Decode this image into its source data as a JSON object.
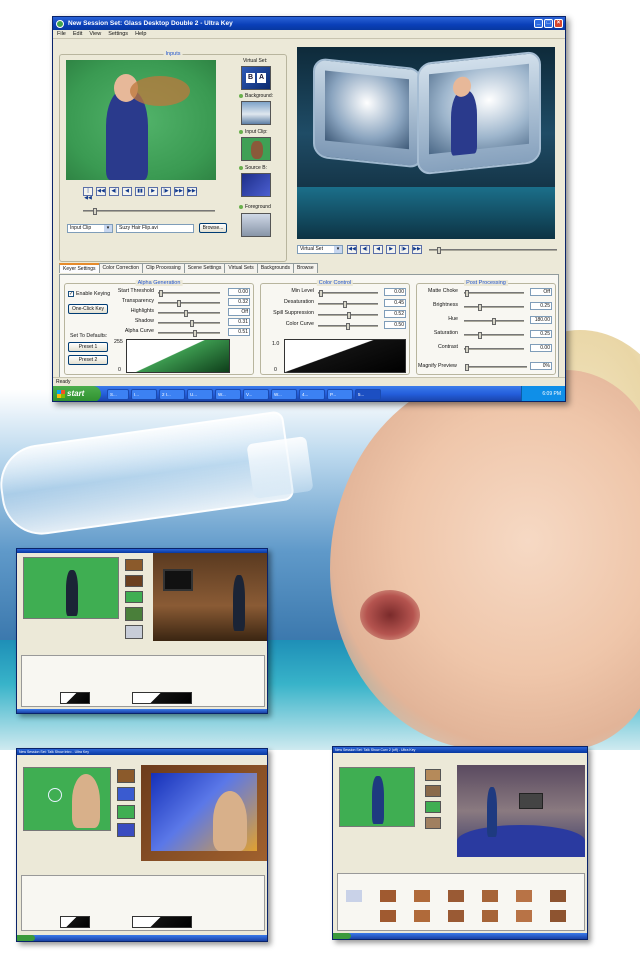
{
  "window": {
    "title": "New Session   Set: Glass Desktop Double 2  - Ultra Key",
    "menu": [
      "File",
      "Edit",
      "View",
      "Settings",
      "Help"
    ]
  },
  "inputs": {
    "group_title": "Inputs",
    "virtual_set_label": "Virtual Set:",
    "background_label": "Background:",
    "input_clip_label": "Input Clip:",
    "source_b_label": "Source B:",
    "foreground_label": "Foreground",
    "transport": [
      "|◀◀",
      "◀◀",
      "◀|",
      "◀",
      "▮▮",
      "▶",
      "|▶",
      "▶▶",
      "▶▶|"
    ],
    "source_select": "Input Clip",
    "file_name": "Suzy Hair Flip.avi",
    "browse_label": "Browse..."
  },
  "output": {
    "view_select": "Virtual Set",
    "transport": [
      "◀◀",
      "◀|",
      "◀",
      "▶",
      "|▶",
      "▶▶"
    ]
  },
  "tabs": [
    "Keyer Settings",
    "Color Correction",
    "Clip Processing",
    "Scene Settings",
    "Virtual Sets",
    "Backgrounds",
    "Browse"
  ],
  "alpha_generation": {
    "title": "Alpha Generation",
    "enable_keying_label": "Enable Keying",
    "one_click_key_label": "One-Click Key",
    "defaults_label": "Set To Defaults:",
    "preset1_label": "Preset 1",
    "preset2_label": "Preset 2",
    "curve_top": "255",
    "curve_bottom": "0",
    "rows": [
      {
        "label": "Start Threshold",
        "value": "0.00",
        "level": 0.02
      },
      {
        "label": "Transparency",
        "value": "0.32",
        "level": 0.32
      },
      {
        "label": "Highlights",
        "value": "Off",
        "level": 0.45
      },
      {
        "label": "Shadow",
        "value": "0.31",
        "level": 0.55
      },
      {
        "label": "Alpha Curve",
        "value": "0.51",
        "level": 0.6
      }
    ]
  },
  "color_control": {
    "title": "Color Control",
    "curve_top": "1.0",
    "curve_bottom": "0",
    "rows": [
      {
        "label": "Min Level",
        "value": "0.00",
        "level": 0.02
      },
      {
        "label": "Desaturation",
        "value": "0.45",
        "level": 0.45
      },
      {
        "label": "Spill Suppression",
        "value": "0.52",
        "level": 0.52
      },
      {
        "label": "Color Curve",
        "value": "0.50",
        "level": 0.5
      }
    ]
  },
  "post_processing": {
    "title": "Post Processing",
    "rows": [
      {
        "label": "Matte Choke",
        "value": "Off",
        "level": 0.02
      },
      {
        "label": "Brightness",
        "value": "0.25",
        "level": 0.25
      },
      {
        "label": "Hue",
        "value": "180.00",
        "level": 0.5
      },
      {
        "label": "Saturation",
        "value": "0.25",
        "level": 0.25
      },
      {
        "label": "Contrast",
        "value": "0.00",
        "level": 0.02
      }
    ],
    "magnify_label": "Magnify Preview",
    "magnify_value": "0%"
  },
  "status": "Ready",
  "taskbar": {
    "start_label": "start",
    "items": [
      "S...",
      "I...",
      "2 I...",
      "U...",
      "W...",
      "V...",
      "W...",
      "4...",
      "P...",
      "5..."
    ],
    "clock": "6:09 PM"
  },
  "colors": {
    "title_blue": "#0a3fb8",
    "chroma_green": "#3a9a52",
    "taskbar_blue": "#245edb",
    "start_green": "#3b9a3b"
  },
  "mini_windows": [
    {
      "name": "dance",
      "title": ""
    },
    {
      "name": "bubble",
      "title": "New Session   Set: Talk Show Intro - Ultra Key"
    },
    {
      "name": "talkshow",
      "title": "New Session   Set: Talk Show Curv 2 (off) - Ultra Key"
    }
  ]
}
